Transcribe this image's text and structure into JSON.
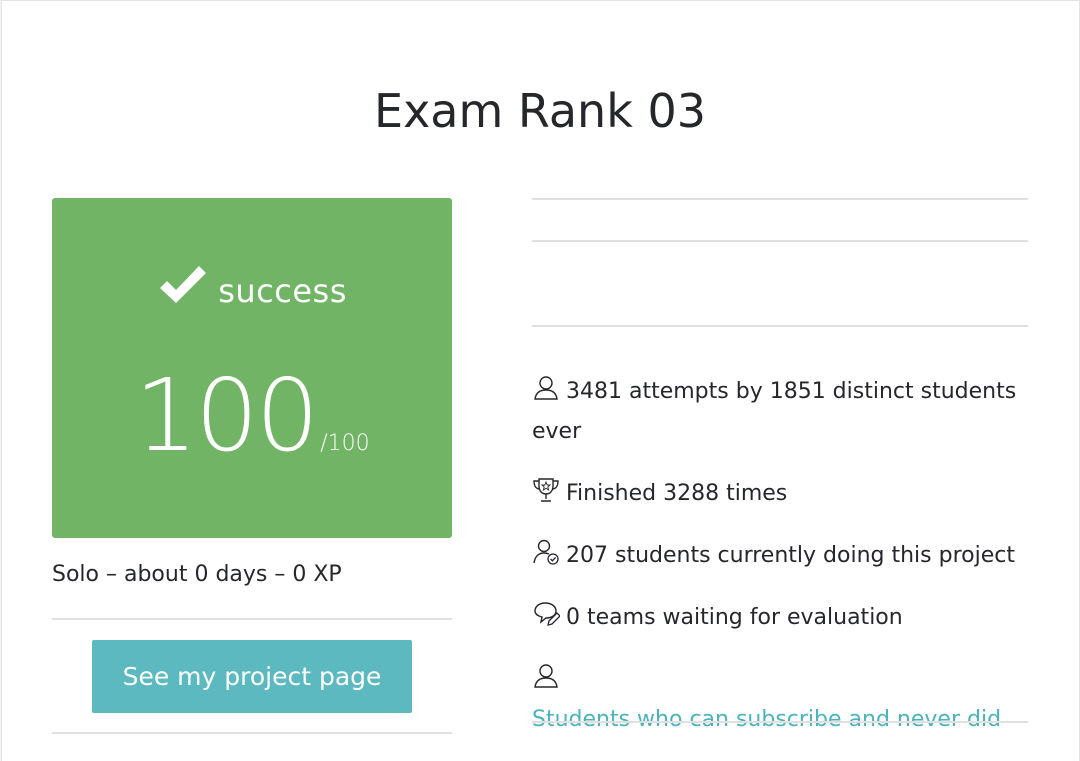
{
  "page": {
    "title": "Exam Rank 03"
  },
  "result": {
    "status": "success",
    "score": "100",
    "score_max": "/100",
    "box_color": "#71b466"
  },
  "meta": {
    "text": "Solo – about 0 days – 0 XP"
  },
  "actions": {
    "project_button_label": "See my project page",
    "button_color": "#5bb9bf"
  },
  "stats": {
    "attempts": "3481 attempts by 1851 distinct students ever",
    "finished": "Finished 3288 times",
    "current": "207 students currently doing this project",
    "waiting": "0 teams waiting for evaluation",
    "subscribe_link": "Students who can subscribe and never did"
  },
  "icons": {
    "status": "check-icon",
    "attempts": "user-icon",
    "finished": "trophy-icon",
    "current": "user-check-icon",
    "waiting": "chat-pencil-icon",
    "subscribe": "user-icon"
  }
}
